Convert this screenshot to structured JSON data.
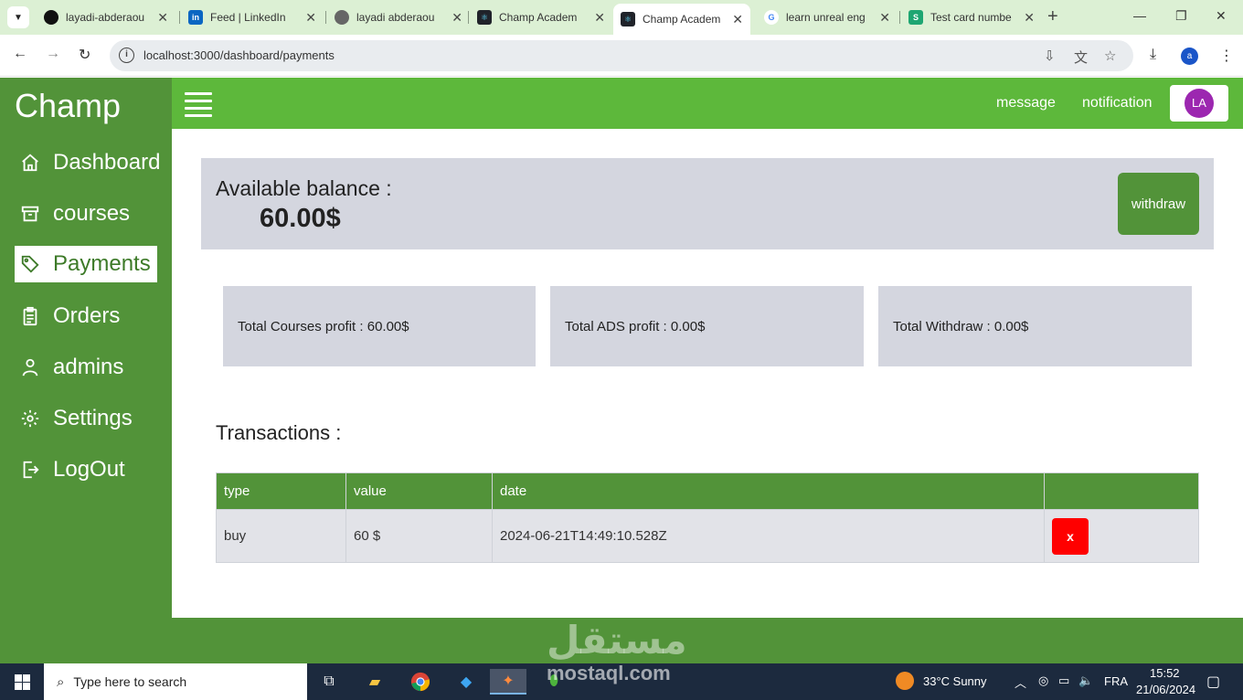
{
  "browser": {
    "tabs": [
      {
        "title": "layadi-abderaou",
        "favicon": "github-icon"
      },
      {
        "title": "Feed | LinkedIn",
        "favicon": "linkedin-icon"
      },
      {
        "title": "layadi abderaou",
        "favicon": "globe-icon"
      },
      {
        "title": "Champ Academ",
        "favicon": "react-icon"
      },
      {
        "title": "Champ Academ",
        "favicon": "react-icon"
      },
      {
        "title": "learn unreal eng",
        "favicon": "google-icon"
      },
      {
        "title": "Test card numbe",
        "favicon": "stripe-icon"
      }
    ],
    "url": "localhost:3000/dashboard/payments",
    "profile_initial": "a"
  },
  "app": {
    "brand": "Champ",
    "sidebar": [
      {
        "label": "Dashboard",
        "icon": "home-icon"
      },
      {
        "label": "courses",
        "icon": "archive-icon"
      },
      {
        "label": "Payments",
        "icon": "tag-icon",
        "active": true
      },
      {
        "label": "Orders",
        "icon": "clipboard-icon"
      },
      {
        "label": "admins",
        "icon": "user-icon"
      },
      {
        "label": "Settings",
        "icon": "gear-icon"
      },
      {
        "label": "LogOut",
        "icon": "logout-icon"
      }
    ],
    "topbar": {
      "message": "message",
      "notification": "notification",
      "avatar_initials": "LA"
    },
    "balance": {
      "label": "Available balance :",
      "amount": "60.00$",
      "withdraw_label": "withdraw"
    },
    "stats": [
      {
        "label": "Total Courses profit : 60.00$"
      },
      {
        "label": "Total ADS profit : 0.00$"
      },
      {
        "label": "Total Withdraw : 0.00$"
      }
    ],
    "transactions": {
      "title": "Transactions :",
      "columns": [
        "type",
        "value",
        "date",
        ""
      ],
      "rows": [
        {
          "type": "buy",
          "value": "60 $",
          "date": "2024-06-21T14:49:10.528Z",
          "action": "x"
        }
      ]
    },
    "watermark": {
      "arabic": "مستقل",
      "latin": "mostaql.com"
    }
  },
  "taskbar": {
    "search_placeholder": "Type here to search",
    "weather": "33°C  Sunny",
    "language": "FRA",
    "time": "15:52",
    "date": "21/06/2024"
  },
  "colors": {
    "sidebar": "#529339",
    "topbar": "#5db83b",
    "card": "#d4d6df",
    "danger": "#ff0000",
    "avatar": "#9c27b0"
  }
}
